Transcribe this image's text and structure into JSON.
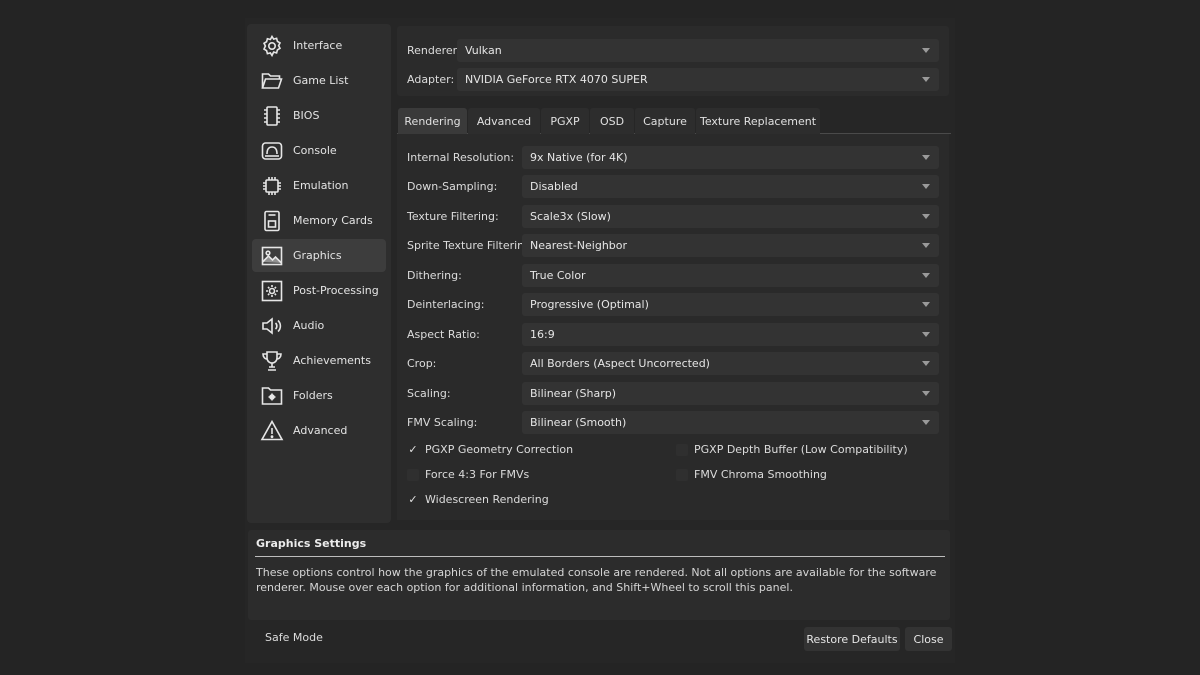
{
  "sidebar": {
    "items": [
      {
        "label": "Interface",
        "icon": "gear-icon"
      },
      {
        "label": "Game List",
        "icon": "folder-open-icon"
      },
      {
        "label": "BIOS",
        "icon": "chip-icon"
      },
      {
        "label": "Console",
        "icon": "console-icon"
      },
      {
        "label": "Emulation",
        "icon": "cpu-icon"
      },
      {
        "label": "Memory Cards",
        "icon": "memory-card-icon"
      },
      {
        "label": "Graphics",
        "icon": "image-icon",
        "active": true
      },
      {
        "label": "Post-Processing",
        "icon": "sun-icon"
      },
      {
        "label": "Audio",
        "icon": "speaker-icon"
      },
      {
        "label": "Achievements",
        "icon": "trophy-icon"
      },
      {
        "label": "Folders",
        "icon": "folder-gear-icon"
      },
      {
        "label": "Advanced",
        "icon": "warning-icon"
      }
    ]
  },
  "top": {
    "renderer_label": "Renderer:",
    "renderer_value": "Vulkan",
    "adapter_label": "Adapter:",
    "adapter_value": "NVIDIA GeForce RTX 4070 SUPER"
  },
  "tabs": [
    "Rendering",
    "Advanced",
    "PGXP",
    "OSD",
    "Capture",
    "Texture Replacement"
  ],
  "settings": [
    {
      "label": "Internal Resolution:",
      "value": "9x Native (for 4K)"
    },
    {
      "label": "Down-Sampling:",
      "value": "Disabled"
    },
    {
      "label": "Texture Filtering:",
      "value": "Scale3x (Slow)"
    },
    {
      "label": "Sprite Texture Filtering:",
      "value": "Nearest-Neighbor"
    },
    {
      "label": "Dithering:",
      "value": "True Color"
    },
    {
      "label": "Deinterlacing:",
      "value": "Progressive (Optimal)"
    },
    {
      "label": "Aspect Ratio:",
      "value": "16:9"
    },
    {
      "label": "Crop:",
      "value": "All Borders (Aspect Uncorrected)"
    },
    {
      "label": "Scaling:",
      "value": "Bilinear (Sharp)"
    },
    {
      "label": "FMV Scaling:",
      "value": "Bilinear (Smooth)"
    }
  ],
  "checks": [
    {
      "label": "PGXP Geometry Correction",
      "checked": true
    },
    {
      "label": "PGXP Depth Buffer (Low Compatibility)",
      "checked": false
    },
    {
      "label": "Force 4:3 For FMVs",
      "checked": false
    },
    {
      "label": "FMV Chroma Smoothing",
      "checked": false
    },
    {
      "label": "Widescreen Rendering",
      "checked": true
    }
  ],
  "description": {
    "title": "Graphics Settings",
    "text": "These options control how the graphics of the emulated console are rendered. Not all options are available for the software renderer. Mouse over each option for additional information, and Shift+Wheel to scroll this panel."
  },
  "footer": {
    "safe_mode": "Safe Mode",
    "restore": "Restore Defaults",
    "close": "Close"
  },
  "check_mark": "✓"
}
